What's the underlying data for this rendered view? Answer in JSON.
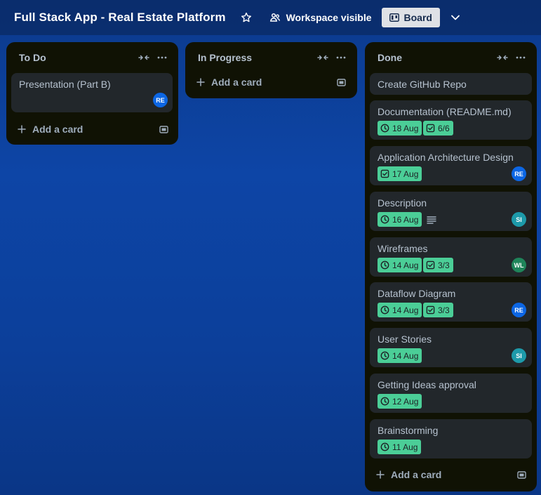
{
  "header": {
    "board_title": "Full Stack App - Real Estate Platform",
    "visibility_label": "Workspace visible",
    "view_label": "Board"
  },
  "lists": [
    {
      "title": "To Do",
      "add_label": "Add a card",
      "cards": [
        {
          "title": "Presentation (Part B)",
          "member": "RE"
        }
      ]
    },
    {
      "title": "In Progress",
      "add_label": "Add a card",
      "cards": []
    },
    {
      "title": "Done",
      "add_label": "Add a card",
      "cards": [
        {
          "title": "Create GitHub Repo"
        },
        {
          "title": "Documentation (README.md)",
          "due": "18 Aug",
          "checklist": "6/6"
        },
        {
          "title": "Application Architecture Design",
          "due": "17 Aug",
          "member": "RE"
        },
        {
          "title": "Description",
          "due": "16 Aug",
          "member": "SI"
        },
        {
          "title": "Wireframes",
          "due": "14 Aug",
          "checklist": "3/3",
          "member": "WL"
        },
        {
          "title": "Dataflow Diagram",
          "due": "14 Aug",
          "checklist": "3/3",
          "member": "RE"
        },
        {
          "title": "User Stories",
          "due": "14 Aug",
          "member": "SI"
        },
        {
          "title": "Getting Ideas approval",
          "due": "12 Aug"
        },
        {
          "title": "Brainstorming",
          "due": "11 Aug"
        }
      ]
    }
  ],
  "colors": {
    "badge_complete": "#4bce97",
    "avatar_re": "#0c66e4",
    "avatar_si": "#1d9aaa",
    "avatar_wl": "#1f845a"
  },
  "icons": [
    "star-icon",
    "workspace-visible-icon",
    "board-icon",
    "chevron-down-icon",
    "collapse-icon",
    "more-icon",
    "plus-icon",
    "template-icon",
    "clock-icon",
    "checklist-icon",
    "description-icon"
  ]
}
